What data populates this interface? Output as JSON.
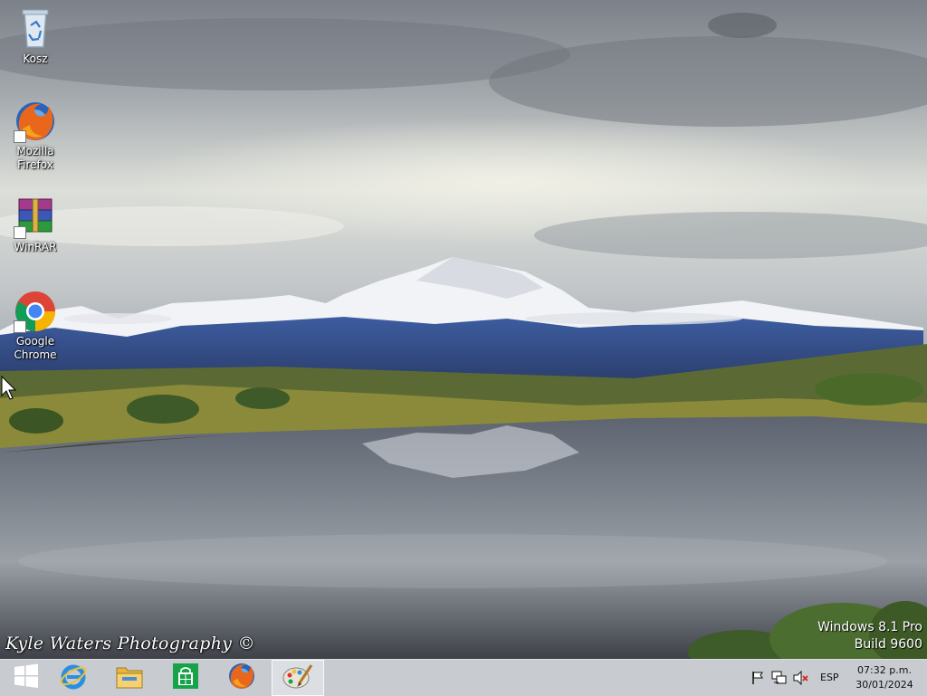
{
  "desktop": {
    "icons": [
      {
        "label": "Kosz",
        "icon": "recycle-bin-icon"
      },
      {
        "label": "Mozilla\nFirefox",
        "line1": "Mozilla",
        "line2": "Firefox",
        "icon": "firefox-icon"
      },
      {
        "label": "WinRAR",
        "icon": "winrar-icon"
      },
      {
        "label": "Google\nChrome",
        "line1": "Google",
        "line2": "Chrome",
        "icon": "chrome-icon"
      }
    ],
    "photo_credit": "Kyle Waters Photography ©",
    "watermark": {
      "edition": "Windows 8.1 Pro",
      "build": "Build 9600"
    }
  },
  "taskbar": {
    "pinned": [
      {
        "name": "Start",
        "icon": "windows-logo-icon"
      },
      {
        "name": "Internet Explorer",
        "icon": "internet-explorer-icon"
      },
      {
        "name": "File Explorer",
        "icon": "file-explorer-icon"
      },
      {
        "name": "Store",
        "icon": "store-icon"
      },
      {
        "name": "Mozilla Firefox",
        "icon": "firefox-icon"
      },
      {
        "name": "Paint",
        "icon": "paint-icon",
        "active": true
      }
    ],
    "tray": {
      "icons": [
        "action-center-flag-icon",
        "network-icon",
        "volume-muted-icon"
      ],
      "language": "ESP",
      "time": "07:32 p.m.",
      "date": "30/01/2024"
    }
  },
  "colors": {
    "taskbar": "#bcc0c6",
    "accent": "#1e5ea8"
  }
}
